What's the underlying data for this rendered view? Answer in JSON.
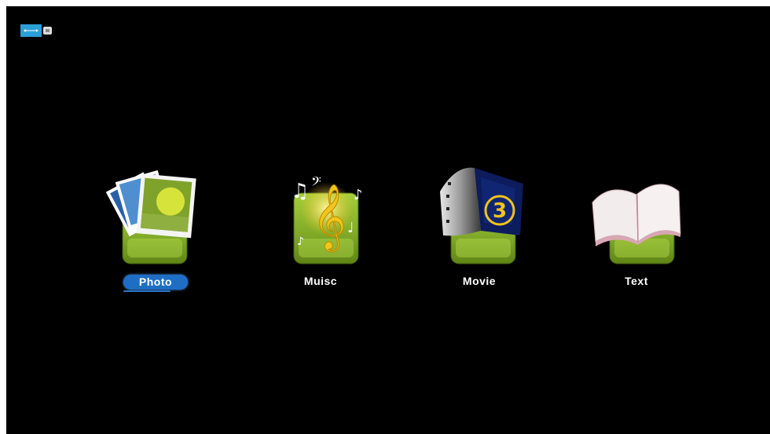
{
  "status_bar": {
    "usb_icon": "usb-drive-icon"
  },
  "menu": {
    "items": [
      {
        "label": "Photo",
        "icon": "photo-icon",
        "selected": true
      },
      {
        "label": "Muisc",
        "icon": "music-icon",
        "selected": false
      },
      {
        "label": "Movie",
        "icon": "movie-icon",
        "selected": false
      },
      {
        "label": "Text",
        "icon": "text-book-icon",
        "selected": false
      }
    ]
  },
  "colors": {
    "background": "#000000",
    "selection": "#1f6ec6",
    "tile_green": "#7fa828",
    "usb_blue": "#2a9fd8"
  }
}
